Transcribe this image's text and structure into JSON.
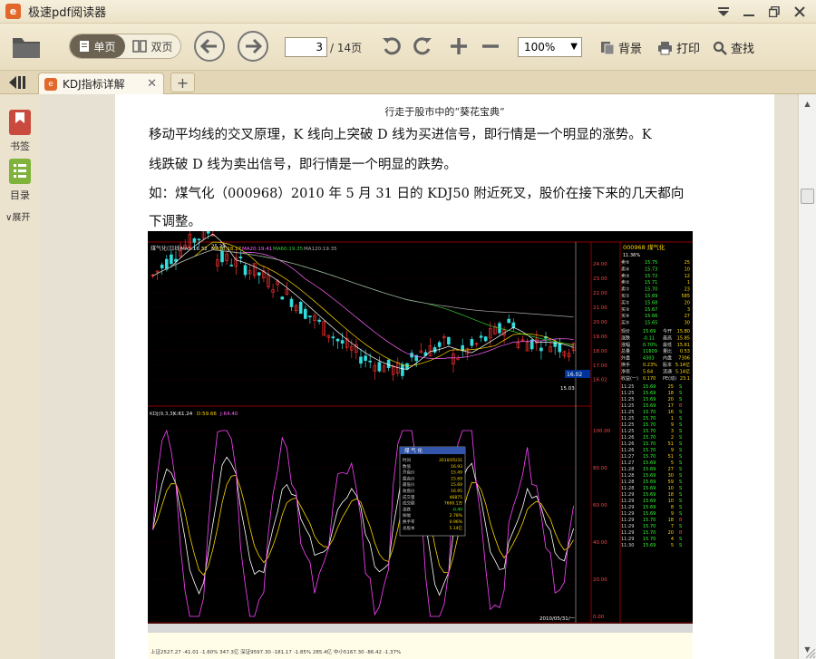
{
  "app": {
    "title": "极速pdf阅读器",
    "logo_letter": "e"
  },
  "toolbar": {
    "single_page_label": "单页",
    "double_page_label": "双页",
    "page_current": "3",
    "page_total": "/ 14页",
    "zoom": "100%",
    "background_label": "背景",
    "print_label": "打印",
    "find_label": "查找"
  },
  "tabs": [
    {
      "title": "KDJ指标详解"
    }
  ],
  "sidebar": {
    "bookmark_label": "书签",
    "toc_label": "目录",
    "expand_label": "展开"
  },
  "document": {
    "header": "行走于股市中的“葵花宝典”",
    "paragraphs": [
      "移动平均线的交叉原理，K 线向上突破 D 线为买进信号，即行情是一个明显的涨势。K",
      "线跌破 D 线为卖出信号，即行情是一个明显的跌势。",
      "如：煤气化（000968）2010 年 5 月 31 日的 KDJ50 附近死叉，股价在接下来的几天都向",
      "下调整。"
    ]
  },
  "chart_data": {
    "type": "line",
    "title": "煤气化(日线)",
    "stock": {
      "code": "000968",
      "name": "煤气化"
    },
    "upper_panel": {
      "legend": [
        "MA5:16.32",
        "MA10:18.17",
        "MA20:19.41",
        "MA60:19.35",
        "MA120:19.35"
      ],
      "ylim": [
        15.0,
        25.0
      ],
      "ticks": [
        "24.00",
        "23.00",
        "22.00",
        "21.00",
        "20.00",
        "19.00",
        "18.00",
        "17.00",
        "16.02"
      ],
      "annotations": [
        "25.39",
        "15.03"
      ]
    },
    "lower_panel": {
      "legend": [
        "KDJ(9,3,3)",
        "K:61.24",
        "D:59.66",
        "J:64.40"
      ],
      "ylim": [
        0,
        100
      ],
      "ticks": [
        "100.00",
        "80.00",
        "60.00",
        "40.00",
        "20.00",
        "0.00"
      ]
    },
    "info_box": {
      "title": "煤 气 化",
      "rows": [
        [
          "时间",
          "2010/05/31"
        ],
        [
          "数值",
          "16.93"
        ],
        [
          "开盘价",
          "15.49"
        ],
        [
          "最高价",
          "15.69"
        ],
        [
          "最低价",
          "15.69"
        ],
        [
          "收盘价",
          "16.95"
        ],
        [
          "成交量",
          "46875"
        ],
        [
          "成交额",
          "7600.1万"
        ],
        [
          "涨跌",
          "-0.40"
        ],
        [
          "振幅",
          "2.78%"
        ],
        [
          "换手率",
          "0.96%"
        ],
        [
          "总股本",
          "5.14亿"
        ]
      ]
    },
    "quote": {
      "header": "000968 煤气化",
      "ratio": "11.36%",
      "sells": [
        [
          "卖⑤",
          "15.75",
          "25"
        ],
        [
          "卖④",
          "15.73",
          "10"
        ],
        [
          "卖③",
          "15.72",
          "12"
        ],
        [
          "卖②",
          "15.71",
          "1"
        ],
        [
          "卖①",
          "15.70",
          "23"
        ]
      ],
      "buys": [
        [
          "买①",
          "15.69",
          "585"
        ],
        [
          "买②",
          "15.68",
          "20"
        ],
        [
          "买③",
          "15.67",
          "3"
        ],
        [
          "买④",
          "15.66",
          "27"
        ],
        [
          "买⑤",
          "15.65",
          "30"
        ]
      ],
      "stats": [
        [
          "现价",
          "15.69"
        ],
        [
          "涨跌",
          "-0.11"
        ],
        [
          "涨幅",
          "0.70%"
        ],
        [
          "总量",
          "11609"
        ],
        [
          "外盘",
          "4303"
        ]
      ],
      "stats_right": [
        [
          "今开",
          "15.80"
        ],
        [
          "最高",
          "15.85"
        ],
        [
          "最低",
          "15.61"
        ],
        [
          "量比",
          "0.53"
        ],
        [
          "内盘",
          "7306"
        ]
      ],
      "extra": [
        [
          "换手",
          "0.23%"
        ],
        [
          "净资",
          "5.64"
        ],
        [
          "收益(一)",
          "0.170"
        ]
      ],
      "extra_right": [
        [
          "股本",
          "5.14亿"
        ],
        [
          "流通",
          "5.14亿"
        ],
        [
          "PE(动)",
          "23.1"
        ]
      ],
      "ticks": [
        [
          "11:25",
          "15.69",
          "25",
          "S"
        ],
        [
          "11:25",
          "15.69",
          "18",
          "S"
        ],
        [
          "11:25",
          "15.69",
          "20",
          "S"
        ],
        [
          "11:25",
          "15.69",
          "17",
          "B"
        ],
        [
          "11:25",
          "15.70",
          "16",
          "S"
        ],
        [
          "11:25",
          "15.70",
          "1",
          "S"
        ],
        [
          "11:25",
          "15.70",
          "9",
          "S"
        ],
        [
          "11:25",
          "15.70",
          "3",
          "S"
        ],
        [
          "11:26",
          "15.70",
          "2",
          "S"
        ],
        [
          "11:26",
          "15.70",
          "51",
          "S"
        ],
        [
          "11:26",
          "15.70",
          "9",
          "S"
        ],
        [
          "11:27",
          "15.70",
          "51",
          "S"
        ],
        [
          "11:27",
          "15.69",
          "5",
          "S"
        ],
        [
          "11:28",
          "15.69",
          "27",
          "S"
        ],
        [
          "11:28",
          "15.69",
          "30",
          "S"
        ],
        [
          "11:28",
          "15.69",
          "59",
          "S"
        ],
        [
          "11:28",
          "15.69",
          "10",
          "S"
        ],
        [
          "11:29",
          "15.69",
          "18",
          "S"
        ],
        [
          "11:29",
          "15.69",
          "10",
          "S"
        ],
        [
          "11:29",
          "15.69",
          "8",
          "S"
        ],
        [
          "11:29",
          "15.69",
          "9",
          "S"
        ],
        [
          "11:29",
          "15.70",
          "18",
          "B"
        ],
        [
          "11:29",
          "15.70",
          "7",
          "S"
        ],
        [
          "11:29",
          "15.70",
          "20",
          "B"
        ],
        [
          "11:29",
          "15.70",
          "4",
          "S"
        ],
        [
          "11:30",
          "15.69",
          "5",
          "S"
        ]
      ]
    },
    "date_label": "2010/05/31/一",
    "footer": "上证2527.27 -41.01 -1.60% 347.3亿  深证9597.30 -181.17 -1.85%  285.4亿  中小5167.30 -86.42 -1.37%"
  }
}
